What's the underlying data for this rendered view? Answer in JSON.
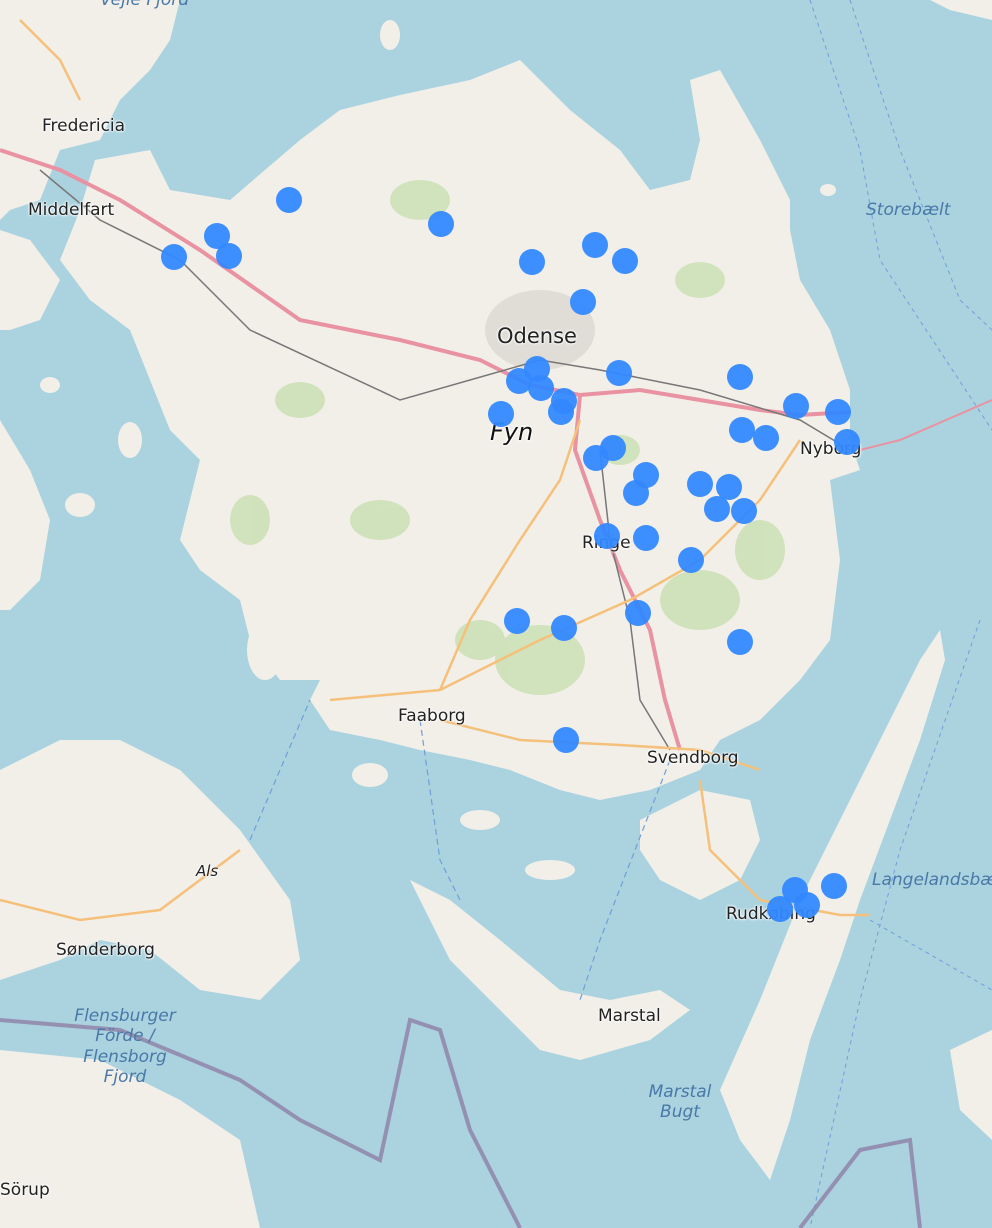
{
  "map": {
    "labels": {
      "fredericia": "Fredericia",
      "middelfart": "Middelfart",
      "odense": "Odense",
      "fyn": "Fyn",
      "nyborg": "Nyborg",
      "ringe": "Ringe",
      "faaborg": "Faaborg",
      "svendborg": "Svendborg",
      "als": "Als",
      "sonderborg": "Sønderborg",
      "rudkobing": "Rudkøbing",
      "marstal": "Marstal",
      "sorup": "Sörup",
      "storebaelt": "Storebælt",
      "langelandsbaelt": "Langelandsbælt",
      "vejle_fjord": "Vejle Fjord",
      "flensburger_line1": "Flensburger",
      "flensburger_line2": "Förde /",
      "flensburger_line3": "Flensborg",
      "flensburger_line4": "Fjord",
      "marstal_bugt_line1": "Marstal",
      "marstal_bugt_line2": "Bugt"
    },
    "marker_color": "#3388ff",
    "marker_count": 44
  }
}
